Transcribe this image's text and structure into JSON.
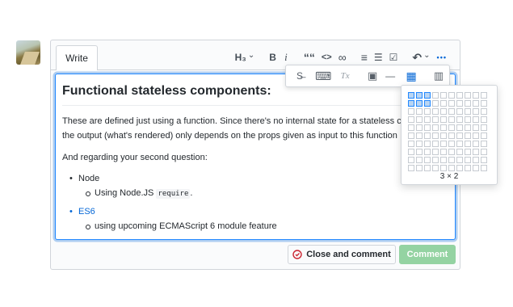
{
  "editor": {
    "tab_write": "Write",
    "toolbar": {
      "heading": "H₃",
      "heading_chevron": "⌄",
      "bold": "B",
      "italic": "i",
      "quote": "““",
      "code": "<>",
      "link": "∞",
      "bulleted_list": "≡",
      "numbered_list": "☰",
      "task_list": "☑",
      "reply": "↶",
      "reply_chevron": "⌄",
      "more": "•••"
    },
    "more_toolbar": {
      "strikethrough": "S̶",
      "keyboard": "⌨",
      "clear_format": "Tx",
      "image": "▣",
      "horizontal_rule": "—",
      "table": "▦",
      "columns": "▥"
    },
    "content": {
      "heading": "Functional stateless components:",
      "paragraph_line1": "These are defined just using a function. Since there's no internal state for a stateless c",
      "paragraph_line2": "the output (what's rendered) only depends on the props given as input to this function",
      "second_paragraph": "And regarding your second question:",
      "list": {
        "item1": "Node",
        "item1_sub_prefix": "Using Node.JS ",
        "item1_sub_code": "require",
        "item1_sub_suffix": ".",
        "item2": "ES6",
        "item2_sub": "using upcoming ECMAScript 6 module feature"
      }
    },
    "table_picker": {
      "label": "3 × 2",
      "columns_selected": 3,
      "rows_selected": 2
    }
  },
  "actions": {
    "close_and_comment": "Close and comment",
    "comment": "Comment"
  },
  "colors": {
    "accent": "#0366d6",
    "focus_border": "#2188ff",
    "comment_button": "#94d3a2",
    "close_icon": "#cb2431"
  }
}
